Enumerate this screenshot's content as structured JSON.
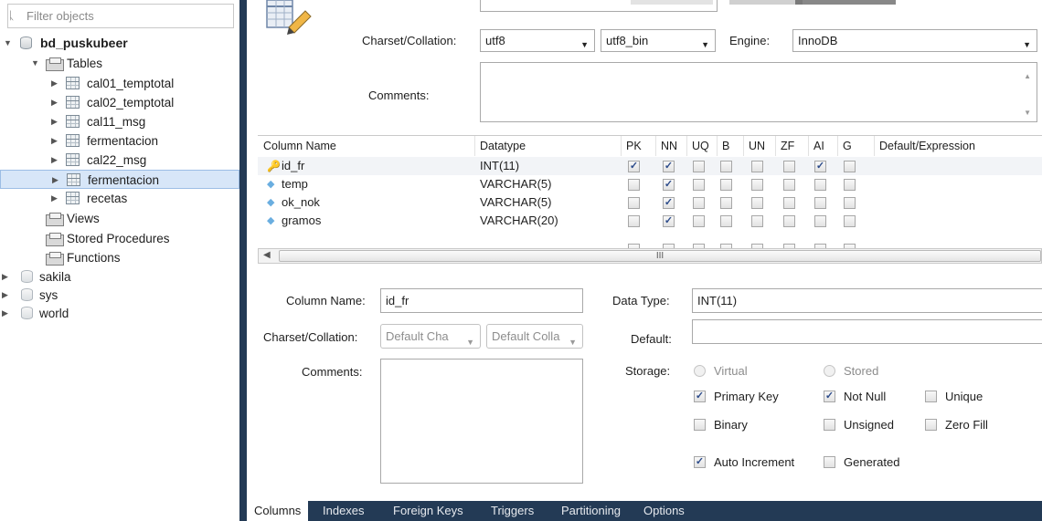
{
  "navigator": {
    "filter_placeholder": "Filter objects",
    "schema_name": "bd_puskubeer",
    "tables_label": "Tables",
    "tables": [
      "cal01_temptotal",
      "cal02_temptotal",
      "cal11_msg",
      "fermentacion",
      "cal22_msg",
      "fermentacion",
      "recetas"
    ],
    "selected_table_index": 5,
    "views_label": "Views",
    "procedures_label": "Stored Procedures",
    "functions_label": "Functions",
    "other_schemas": [
      "sakila",
      "sys",
      "world"
    ]
  },
  "editor": {
    "charset_label": "Charset/Collation:",
    "charset_value": "utf8",
    "collation_value": "utf8_bin",
    "engine_label": "Engine:",
    "engine_value": "InnoDB",
    "comments_label": "Comments:"
  },
  "grid": {
    "headers": [
      "Column Name",
      "Datatype",
      "PK",
      "NN",
      "UQ",
      "B",
      "UN",
      "ZF",
      "AI",
      "G",
      "Default/Expression"
    ],
    "rows": [
      {
        "name": "id_fr",
        "type": "INT(11)",
        "icon": "primary-key-icon",
        "flags": [
          true,
          true,
          false,
          false,
          false,
          false,
          true,
          false
        ]
      },
      {
        "name": "temp",
        "type": "VARCHAR(5)",
        "icon": "column-diamond-icon",
        "flags": [
          false,
          true,
          false,
          false,
          false,
          false,
          false,
          false
        ]
      },
      {
        "name": "ok_nok",
        "type": "VARCHAR(5)",
        "icon": "column-diamond-icon",
        "flags": [
          false,
          true,
          false,
          false,
          false,
          false,
          false,
          false
        ]
      },
      {
        "name": "gramos",
        "type": "VARCHAR(20)",
        "icon": "column-diamond-icon",
        "flags": [
          false,
          true,
          false,
          false,
          false,
          false,
          false,
          false
        ]
      }
    ],
    "scroll_thumb_label": "III"
  },
  "detail": {
    "column_name_label": "Column Name:",
    "column_name_value": "id_fr",
    "charset_label": "Charset/Collation:",
    "charset_value": "Default Cha",
    "collation_value": "Default Colla",
    "comments_label": "Comments:",
    "data_type_label": "Data Type:",
    "data_type_value": "INT(11)",
    "default_label": "Default:",
    "default_value": "",
    "storage_label": "Storage:",
    "virtual_label": "Virtual",
    "stored_label": "Stored",
    "primary_key_label": "Primary Key",
    "primary_key": true,
    "not_null_label": "Not Null",
    "not_null": true,
    "unique_label": "Unique",
    "unique": false,
    "binary_label": "Binary",
    "binary": false,
    "unsigned_label": "Unsigned",
    "unsigned": false,
    "zero_fill_label": "Zero Fill",
    "zero_fill": false,
    "auto_increment_label": "Auto Increment",
    "auto_increment": true,
    "generated_label": "Generated",
    "generated": false
  },
  "tabs": [
    "Columns",
    "Indexes",
    "Foreign Keys",
    "Triggers",
    "Partitioning",
    "Options"
  ],
  "active_tab_index": 0,
  "colors": {
    "sidebar_divider": "#233a55",
    "selection": "#d7e6f8",
    "check": "#2b4a8a"
  }
}
